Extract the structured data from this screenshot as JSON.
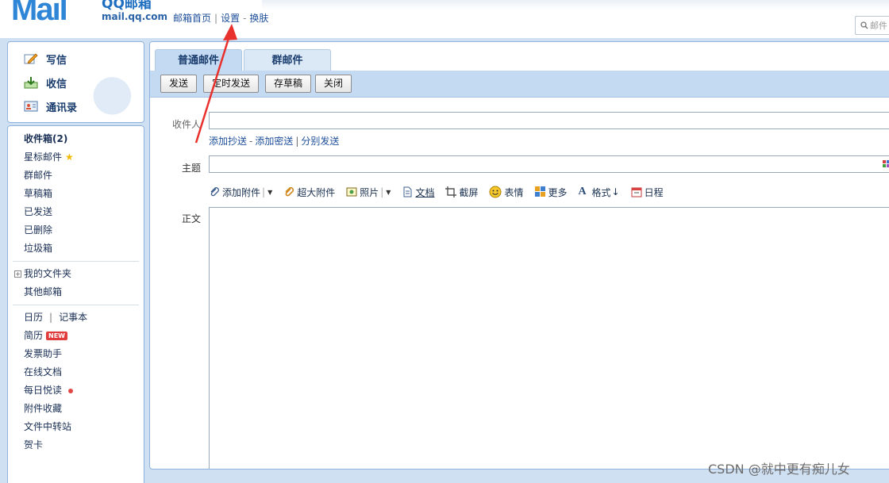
{
  "header": {
    "logo_mark": "Mail",
    "logo_title": "QQ邮箱",
    "logo_sub": "mail.qq.com",
    "link_home": "邮箱首页",
    "sep1": "|",
    "link_settings": "设置",
    "sep2": "-",
    "link_skin": "换肤",
    "search_placeholder": "邮件"
  },
  "quick": {
    "compose": "写信",
    "inbox": "收信",
    "contacts": "通讯录"
  },
  "folders": {
    "group1": [
      "收件箱(2)",
      "星标邮件",
      "群邮件",
      "草稿箱",
      "已发送",
      "已删除",
      "垃圾箱"
    ],
    "myfolders": "我的文件夹",
    "othermail": "其他邮箱",
    "calendar": "日历",
    "calendar_sep": "|",
    "notebook": "记事本",
    "resume": "简历",
    "resume_badge": "NEW",
    "group3": [
      "发票助手",
      "在线文档"
    ],
    "daily_read": "每日悦读",
    "group4": [
      "附件收藏",
      "文件中转站",
      "贺卡"
    ]
  },
  "tabs": {
    "normal": "普通邮件",
    "group": "群邮件"
  },
  "toolbar": {
    "send": "发送",
    "timed_send": "定时发送",
    "save_draft": "存草稿",
    "close": "关闭"
  },
  "form": {
    "to_label": "收件人",
    "add_cc": "添加抄送",
    "dash1": "-",
    "add_bcc": "添加密送",
    "bar": "|",
    "separate_send": "分别发送",
    "subject_label": "主题",
    "body_label": "正文"
  },
  "tools": {
    "attach": "添加附件",
    "big_attach": "超大附件",
    "photo": "照片",
    "doc": "文档",
    "screenshot": "截屏",
    "emoji": "表情",
    "more": "更多",
    "format": "格式",
    "schedule": "日程"
  },
  "watermark": "CSDN @就中更有痴儿女",
  "colors": {
    "accent": "#2f86d6",
    "link": "#1e4f9a",
    "panel_border": "#8fb3dc",
    "toolbar_band": "#c4daf2",
    "annotation_arrow": "#e8302c"
  }
}
